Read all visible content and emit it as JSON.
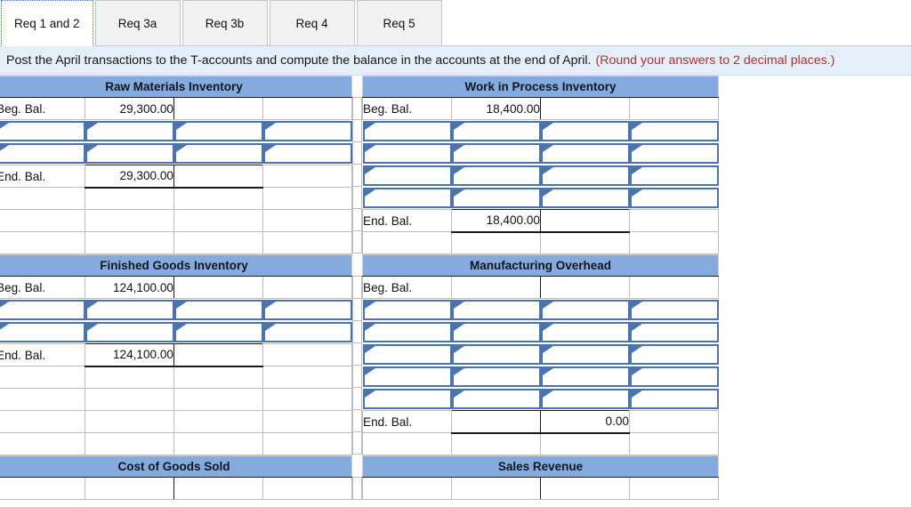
{
  "tabs": [
    {
      "label": "Req 1 and 2",
      "active": true
    },
    {
      "label": "Req 3a",
      "active": false
    },
    {
      "label": "Req 3b",
      "active": false
    },
    {
      "label": "Req 4",
      "active": false
    },
    {
      "label": "Req 5",
      "active": false
    }
  ],
  "instruction": {
    "text": "Post the April transactions to the T-accounts and compute the balance in the accounts at the end of April.",
    "note": "(Round your answers to 2 decimal places.)"
  },
  "labels": {
    "beginning_balance": "Beg. Bal.",
    "ending_balance": "End. Bal."
  },
  "colors": {
    "header_blue": "#85aade",
    "instruction_bg": "#e4eff9",
    "note_red": "#b03030",
    "input_border": "#4a74ab"
  },
  "accounts": {
    "raw_materials": {
      "title": "Raw Materials Inventory",
      "beg_label": "Beg. Bal.",
      "beg_debit": "29,300.00",
      "beg_credit": "",
      "entry_rows": 2,
      "end_label": "End. Bal.",
      "end_debit": "29,300.00",
      "end_credit": ""
    },
    "work_in_process": {
      "title": "Work in Process Inventory",
      "beg_label": "Beg. Bal.",
      "beg_debit": "18,400.00",
      "beg_credit": "",
      "entry_rows": 4,
      "end_label": "End. Bal.",
      "end_debit": "18,400.00",
      "end_credit": ""
    },
    "finished_goods": {
      "title": "Finished Goods Inventory",
      "beg_label": "Beg. Bal.",
      "beg_debit": "124,100.00",
      "beg_credit": "",
      "entry_rows": 2,
      "end_label": "End. Bal.",
      "end_debit": "124,100.00",
      "end_credit": ""
    },
    "manufacturing_overhead": {
      "title": "Manufacturing Overhead",
      "beg_label": "Beg. Bal.",
      "beg_debit": "",
      "beg_credit": "",
      "entry_rows": 5,
      "end_label": "End. Bal.",
      "end_debit": "",
      "end_credit": "0.00"
    },
    "cost_of_goods_sold": {
      "title": "Cost of Goods Sold"
    },
    "sales_revenue": {
      "title": "Sales Revenue"
    }
  }
}
